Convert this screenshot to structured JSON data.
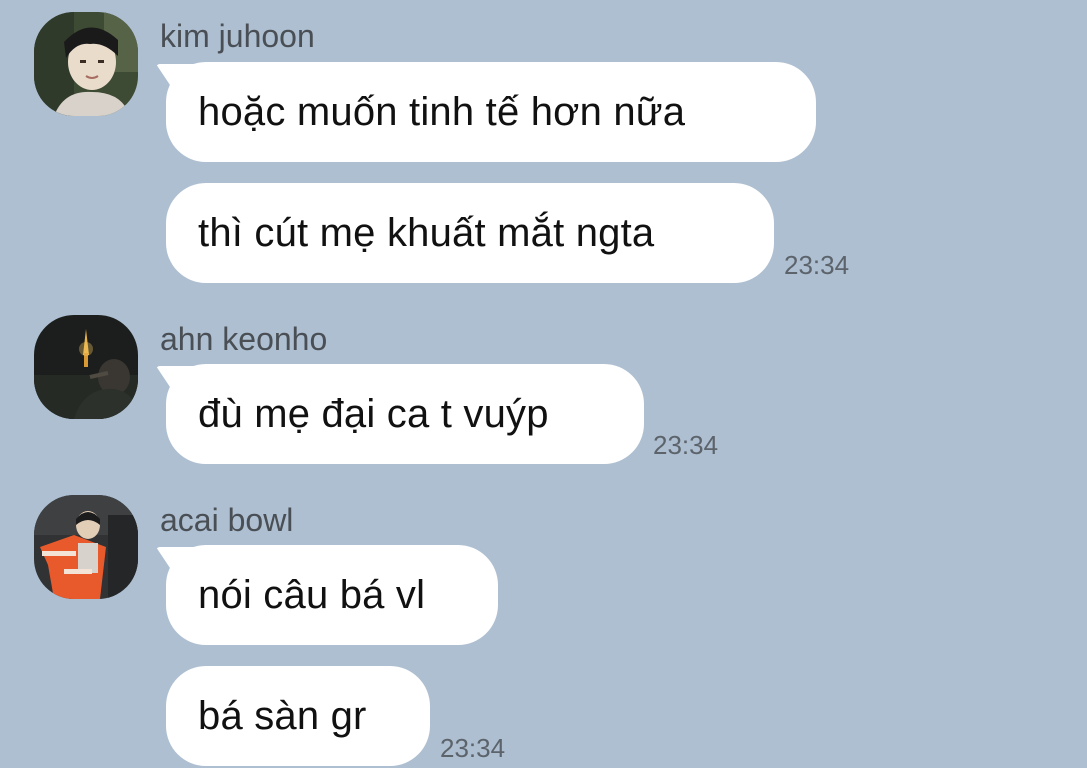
{
  "messages": [
    {
      "sender": "kim juhoon",
      "avatar_icon": "avatar-photo-kim-juhoon",
      "bubbles": [
        "hoặc muốn tinh tế hơn nữa",
        "thì cút mẹ khuất mắt ngta"
      ],
      "time": "23:34"
    },
    {
      "sender": "ahn keonho",
      "avatar_icon": "avatar-photo-ahn-keonho",
      "bubbles": [
        "đù mẹ đại ca t vuýp"
      ],
      "time": "23:34"
    },
    {
      "sender": "acai bowl",
      "avatar_icon": "avatar-photo-acai-bowl",
      "bubbles": [
        "nói câu bá vl",
        "bá sàn gr"
      ],
      "time": "23:34"
    }
  ],
  "colors": {
    "background": "#adbfd1",
    "bubble": "#ffffff",
    "sender_text": "#4a4f55",
    "time_text": "#5c636b"
  }
}
